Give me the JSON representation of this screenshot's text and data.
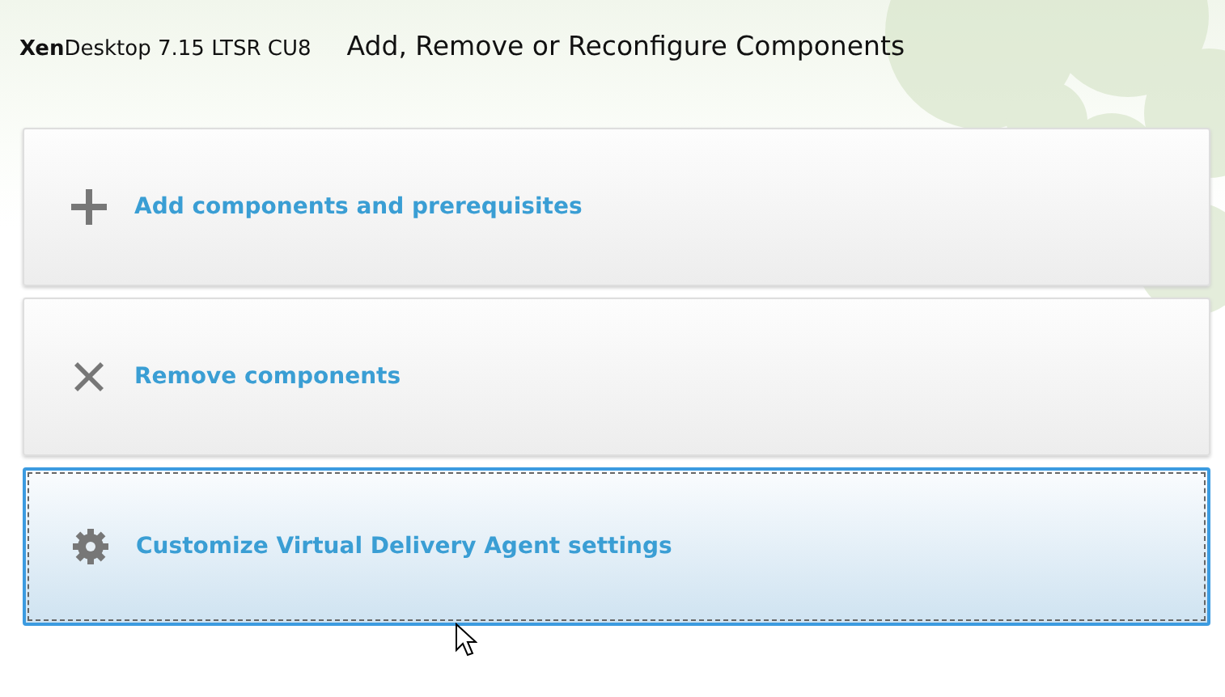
{
  "header": {
    "product": "**Xen**Desktop 7.15 LTSR CU8",
    "title": "Add, Remove or Reconfigure Components"
  },
  "options": [
    {
      "kind": "add",
      "label": "Add components and prerequisites",
      "selected": false
    },
    {
      "kind": "remove",
      "label": "Remove components",
      "selected": false
    },
    {
      "kind": "customize",
      "label": "Customize Virtual Delivery Agent settings",
      "selected": true
    }
  ]
}
